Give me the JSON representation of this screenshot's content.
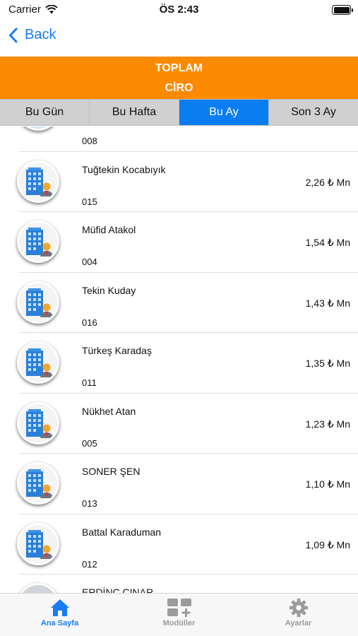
{
  "status_bar": {
    "carrier": "Carrier",
    "time": "ÖS 2:43"
  },
  "nav": {
    "back_label": "Back"
  },
  "header": {
    "line1": "TOPLAM",
    "line2": "CİRO"
  },
  "segments": [
    {
      "label": "Bu Gün",
      "active": false
    },
    {
      "label": "Bu Hafta",
      "active": false
    },
    {
      "label": "Bu Ay",
      "active": true
    },
    {
      "label": "Son 3 Ay",
      "active": false
    }
  ],
  "list": {
    "partial_top": {
      "code": "008"
    },
    "rows": [
      {
        "name": "Tuğtekin Kocabıyık",
        "code": "015",
        "amount": "2,26 ₺ Mn"
      },
      {
        "name": "Müfid Atakol",
        "code": "004",
        "amount": "1,54 ₺ Mn"
      },
      {
        "name": "Tekin Kuday",
        "code": "016",
        "amount": "1,43 ₺ Mn"
      },
      {
        "name": "Türkeş Karadaş",
        "code": "011",
        "amount": "1,35 ₺ Mn"
      },
      {
        "name": "Nükhet Atan",
        "code": "005",
        "amount": "1,23 ₺ Mn"
      },
      {
        "name": "SONER ŞEN",
        "code": "013",
        "amount": "1,10 ₺ Mn"
      },
      {
        "name": "Battal Karaduman",
        "code": "012",
        "amount": "1,09 ₺ Mn"
      }
    ],
    "partial_bottom": {
      "name": "ERDİNÇ ÇINAR"
    }
  },
  "tabs": [
    {
      "label": "Ana Sayfa",
      "icon": "home-icon",
      "active": true
    },
    {
      "label": "Modüller",
      "icon": "modules-icon",
      "active": false
    },
    {
      "label": "Ayarlar",
      "icon": "gear-icon",
      "active": false
    }
  ],
  "colors": {
    "accent": "#1a7cf5",
    "header": "#fb8a00",
    "segment_active": "#0a7ef0"
  }
}
